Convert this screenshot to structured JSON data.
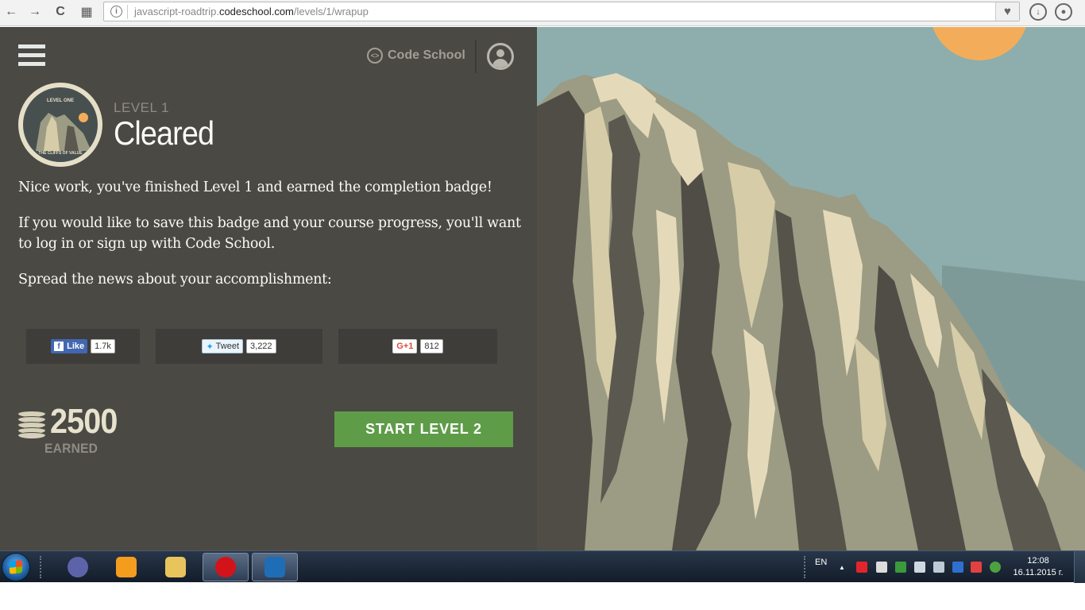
{
  "browser": {
    "url_prefix": "javascript-roadtrip.",
    "url_domain": "codeschool.com",
    "url_path": "/levels/1/wrapup",
    "back_icon": "←",
    "forward_icon": "→",
    "reload_icon": "C",
    "apps_icon": "▦",
    "heart_icon": "♥",
    "download_icon": "↓",
    "account_icon": "●"
  },
  "header": {
    "brand": "Code School",
    "brand_icon": "<>"
  },
  "badge": {
    "top_text": "LEVEL ONE",
    "bottom_text": "THE CLIFFS OF VALUE"
  },
  "level": {
    "label": "LEVEL 1",
    "title": "Cleared"
  },
  "content": {
    "para1": "Nice work, you've finished Level 1 and earned the completion badge!",
    "para2": "If you would like to save this badge and your course progress, you'll want to log in or sign up with Code School.",
    "para3": "Spread the news about your accomplishment:"
  },
  "share": {
    "facebook": {
      "label": "Like",
      "icon": "f",
      "count": "1.7k"
    },
    "twitter": {
      "label": "Tweet",
      "count": "3,222"
    },
    "google": {
      "label": "G+1",
      "count": "812"
    }
  },
  "score": {
    "points": "2500",
    "earned_label": "EARNED"
  },
  "cta": {
    "start_label": "START LEVEL 2"
  },
  "taskbar": {
    "language": "EN",
    "time": "12:08",
    "date": "16.11.2015 г.",
    "tray_arrow": "▲"
  },
  "colors": {
    "panel_bg": "#4a4944",
    "sky": "#8daeac",
    "sun": "#f3ad5a",
    "cta_green": "#5e9c48",
    "rock_light": "#e4dab9",
    "rock_mid": "#9c9b84",
    "rock_dark": "#4f4d45"
  }
}
